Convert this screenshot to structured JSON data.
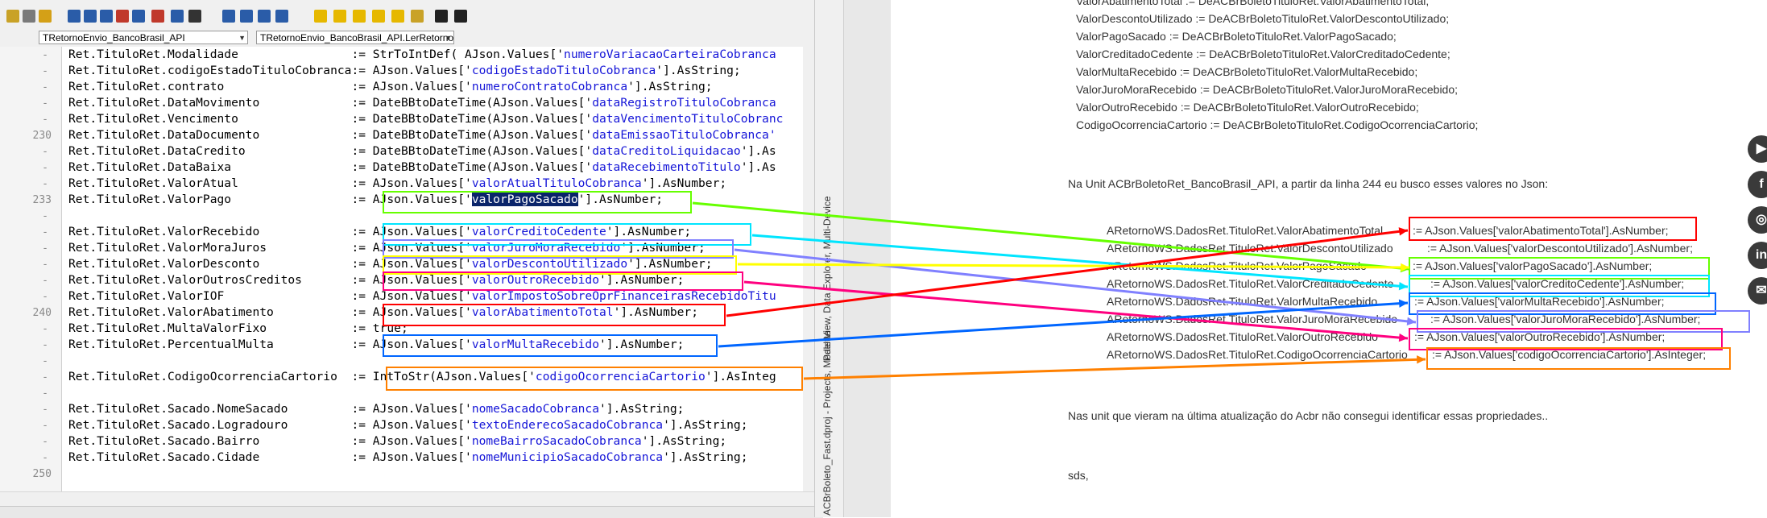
{
  "ide": {
    "unit_combo": "TRetornoEnvio_BancoBrasil_API",
    "method_combo": "TRetornoEnvio_BancoBrasil_API.LerRetorno",
    "sidetabs": {
      "panel_a": "ACBrBoleto_Fast.dproj - Projects, Model View, Data Explorer, Multi-Device",
      "panel_b": "Palette"
    },
    "line_numbers": [
      "230",
      "233",
      "240",
      "250"
    ],
    "code_lines": [
      {
        "l": "Ret.TituloRet.Modalidade",
        "p": ":= StrToIntDef( AJson.Values['",
        "s": "numeroVariacaoCarteiraCobranca",
        "q": ""
      },
      {
        "l": "Ret.TituloRet.codigoEstadoTituloCobranca",
        "p": ":= AJson.Values['",
        "s": "codigoEstadoTituloCobranca",
        "q": "'].AsString;"
      },
      {
        "l": "Ret.TituloRet.contrato",
        "p": ":= AJson.Values['",
        "s": "numeroContratoCobranca",
        "q": "'].AsString;"
      },
      {
        "l": "Ret.TituloRet.DataMovimento",
        "p": ":= DateBBtoDateTime(AJson.Values['",
        "s": "dataRegistroTituloCobranca",
        "q": ""
      },
      {
        "l": "Ret.TituloRet.Vencimento",
        "p": ":= DateBBtoDateTime(AJson.Values['",
        "s": "dataVencimentoTituloCobranc",
        "q": ""
      },
      {
        "l": "Ret.TituloRet.DataDocumento",
        "p": ":= DateBBtoDateTime(AJson.Values['",
        "s": "dataEmissaoTituloCobranca'",
        "q": ""
      },
      {
        "l": "Ret.TituloRet.DataCredito",
        "p": ":= DateBBtoDateTime(AJson.Values['",
        "s": "dataCreditoLiquidacao",
        "q": "'].As"
      },
      {
        "l": "Ret.TituloRet.DataBaixa",
        "p": ":= DateBBtoDateTime(AJson.Values['",
        "s": "dataRecebimentoTitulo",
        "q": "'].As"
      },
      {
        "l": "Ret.TituloRet.ValorAtual",
        "p": ":= AJson.Values['",
        "s": "valorAtualTituloCobranca",
        "q": "'].AsNumber;"
      },
      {
        "l": "Ret.TituloRet.ValorPago",
        "p": ":= AJson.Values['",
        "s": "valorPagoSacado",
        "q": "'].AsNumber;"
      },
      {
        "l": "",
        "p": "",
        "s": "",
        "q": ""
      },
      {
        "l": "Ret.TituloRet.ValorRecebido",
        "p": ":= AJson.Values['",
        "s": "valorCreditoCedente",
        "q": "'].AsNumber;"
      },
      {
        "l": "Ret.TituloRet.ValorMoraJuros",
        "p": ":= AJson.Values['",
        "s": "valorJuroMoraRecebido",
        "q": "'].AsNumber;"
      },
      {
        "l": "Ret.TituloRet.ValorDesconto",
        "p": ":= AJson.Values['",
        "s": "valorDescontoUtilizado",
        "q": "'].AsNumber;"
      },
      {
        "l": "Ret.TituloRet.ValorOutrosCreditos",
        "p": ":= AJson.Values['",
        "s": "valorOutroRecebido",
        "q": "'].AsNumber;"
      },
      {
        "l": "Ret.TituloRet.ValorIOF",
        "p": ":= AJson.Values['",
        "s": "valorImpostoSobreOprFinanceirasRecebidoTitu",
        "q": ""
      },
      {
        "l": "Ret.TituloRet.ValorAbatimento",
        "p": ":= AJson.Values['",
        "s": "valorAbatimentoTotal",
        "q": "'].AsNumber;"
      },
      {
        "l": "Ret.TituloRet.MultaValorFixo",
        "p": ":= true;",
        "s": "",
        "q": ""
      },
      {
        "l": "Ret.TituloRet.PercentualMulta",
        "p": ":= AJson.Values['",
        "s": "valorMultaRecebido",
        "q": "'].AsNumber;"
      },
      {
        "l": "",
        "p": "",
        "s": "",
        "q": ""
      },
      {
        "l": "Ret.TituloRet.CodigoOcorrenciaCartorio",
        "p": ":= IntToStr(AJson.Values['",
        "s": "codigoOcorrenciaCartorio",
        "q": "'].AsInteg"
      },
      {
        "l": "",
        "p": "",
        "s": "",
        "q": ""
      },
      {
        "l": "Ret.TituloRet.Sacado.NomeSacado",
        "p": ":= AJson.Values['",
        "s": "nomeSacadoCobranca",
        "q": "'].AsString;"
      },
      {
        "l": "Ret.TituloRet.Sacado.Logradouro",
        "p": ":= AJson.Values['",
        "s": "textoEnderecoSacadoCobranca",
        "q": "'].AsString;"
      },
      {
        "l": "Ret.TituloRet.Sacado.Bairro",
        "p": ":= AJson.Values['",
        "s": "nomeBairroSacadoCobranca",
        "q": "'].AsString;"
      },
      {
        "l": "Ret.TituloRet.Sacado.Cidade",
        "p": ":= AJson.Values['",
        "s": "nomeMunicipioSacadoCobranca",
        "q": "'].AsString;"
      }
    ]
  },
  "forum": {
    "top_lines": [
      "ValorAbatimentoTotal := DeACBrBoletoTituloRet.ValorAbatimentoTotal;",
      "ValorDescontoUtilizado  := DeACBrBoletoTituloRet.ValorDescontoUtilizado;",
      "ValorPagoSacado  := DeACBrBoletoTituloRet.ValorPagoSacado;",
      "ValorCreditadoCedente  := DeACBrBoletoTituloRet.ValorCreditadoCedente;",
      "ValorMultaRecebido := DeACBrBoletoTituloRet.ValorMultaRecebido;",
      "ValorJuroMoraRecebido  := DeACBrBoletoTituloRet.ValorJuroMoraRecebido;",
      "ValorOutroRecebido := DeACBrBoletoTituloRet.ValorOutroRecebido;",
      "CodigoOcorrenciaCartorio := DeACBrBoletoTituloRet.CodigoOcorrenciaCartorio;"
    ],
    "intro": "Na Unit ACBrBoletoRet_BancoBrasil_API, a partir da linha 244 eu busco esses valores no Json:",
    "left_lines": [
      "ARetornoWS.DadosRet.TituloRet.ValorAbatimentoTotal",
      "ARetornoWS.DadosRet.TituloRet.ValorDescontoUtilizado",
      "ARetornoWS.DadosRet.TituloRet.ValorPagoSacado",
      "ARetornoWS.DadosRet.TituloRet.ValorCreditadoCedente",
      "ARetornoWS.DadosRet.TituloRet.ValorMultaRecebido",
      "ARetornoWS.DadosRet.TituloRet.ValorJuroMoraRecebido",
      "ARetornoWS.DadosRet.TituloRet.ValorOutroRecebido",
      "ARetornoWS.DadosRet.TituloRet.CodigoOcorrenciaCartorio"
    ],
    "right_lines": [
      ":= AJson.Values['valorAbatimentoTotal'].AsNumber;",
      ":= AJson.Values['valorDescontoUtilizado'].AsNumber;",
      ":= AJson.Values['valorPagoSacado'].AsNumber;",
      ":= AJson.Values['valorCreditoCedente'].AsNumber;",
      ":= AJson.Values['valorMultaRecebido'].AsNumber;",
      ":= AJson.Values['valorJuroMoraRecebido'].AsNumber;",
      ":= AJson.Values['valorOutroRecebido'].AsNumber;",
      ":= AJson.Values['codigoOcorrenciaCartorio'].AsInteger;"
    ],
    "note": "Nas unit que vieram na última atualização do Acbr não consegui identificar essas propriedades..",
    "signoff": "sds,"
  },
  "colors": {
    "abatimento": "#ff0000",
    "desconto": "#ffff00",
    "pago": "#66ff00",
    "credito": "#00e5ff",
    "multa": "#0066ff",
    "juro": "#8080ff",
    "outro": "#ff007f",
    "cartorio": "#ff8000"
  },
  "social_icons": [
    "youtube-icon",
    "facebook-icon",
    "instagram-icon",
    "linkedin-icon",
    "email-icon"
  ]
}
